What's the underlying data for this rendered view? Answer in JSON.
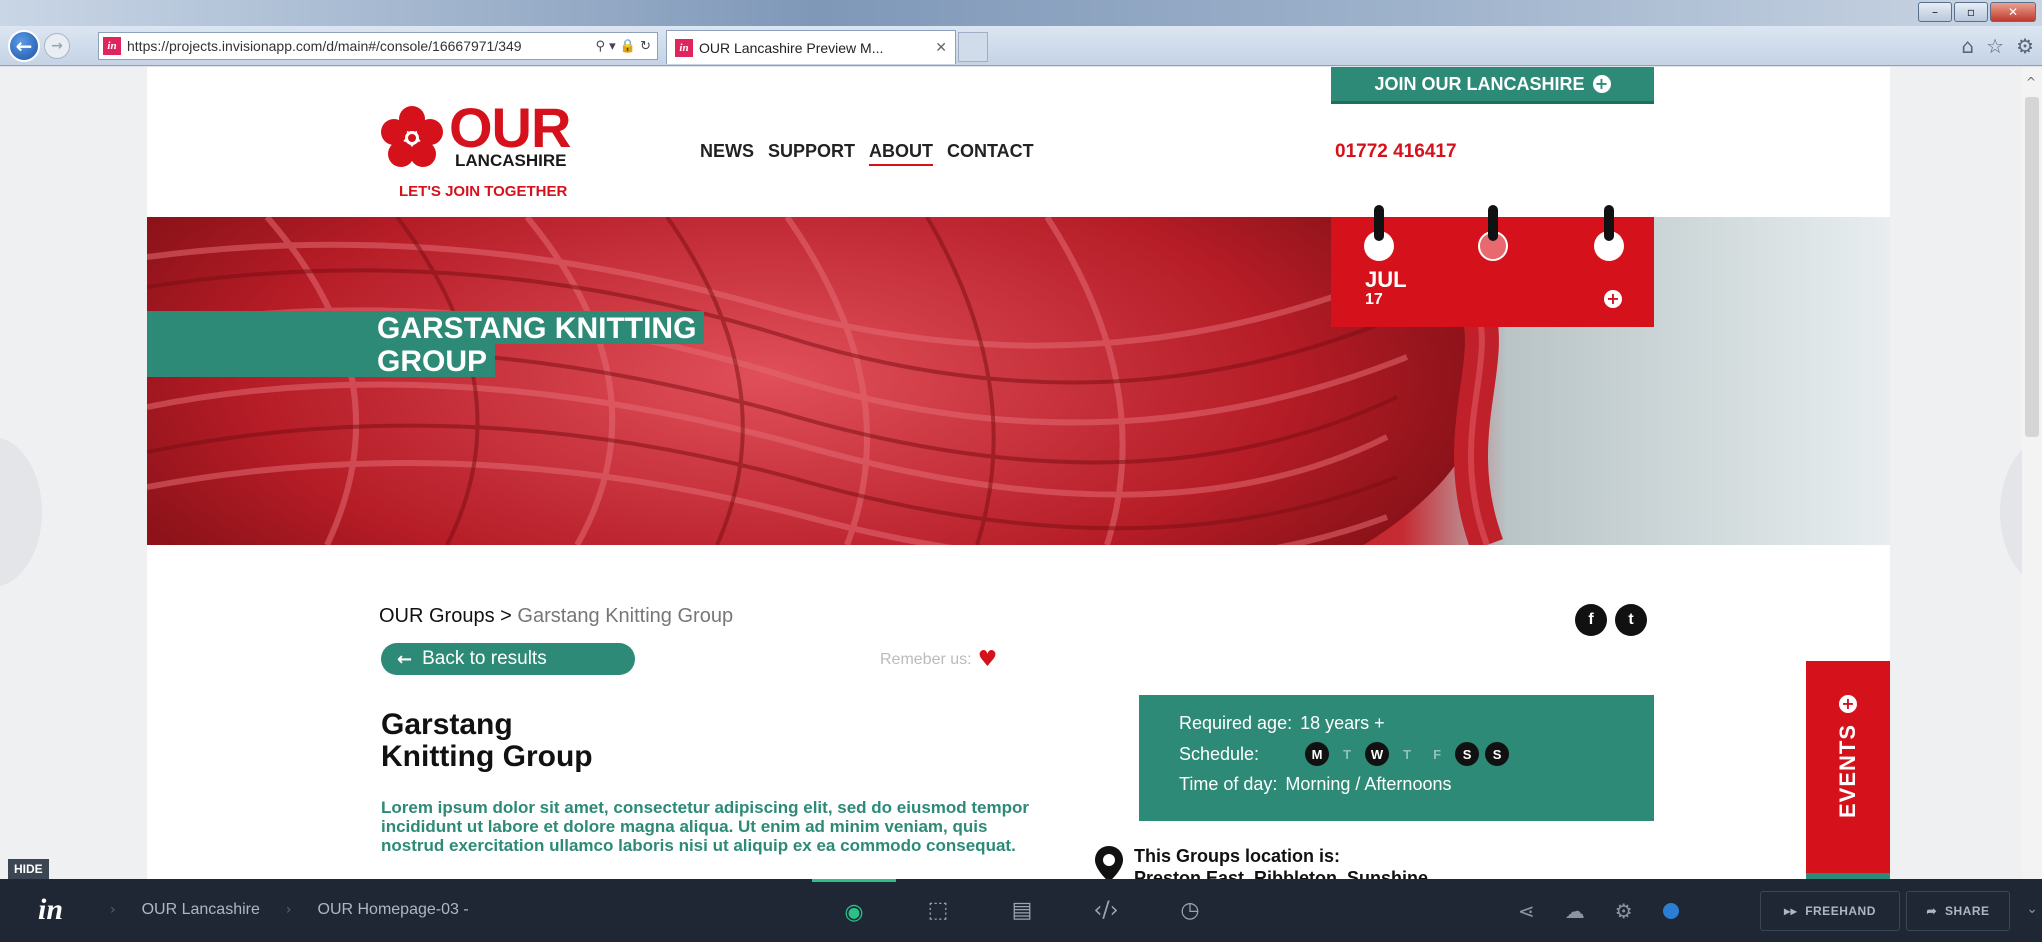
{
  "browser": {
    "url": "https://projects.invisionapp.com/d/main#/console/16667971/349",
    "url_icons": "⚲ ▾ 🔒 ↻",
    "tab_title": "OUR Lancashire Preview M...",
    "tab_close": "✕",
    "favicon_letter": "in",
    "win_minimize": "–",
    "win_maximize": "▫",
    "win_close": "✕",
    "home_icon": "⌂",
    "star_icon": "☆",
    "gear_icon": "⚙"
  },
  "site": {
    "join_label": "JOIN OUR LANCASHIRE",
    "logo_our": "OUR",
    "logo_lancashire": "LANCASHIRE",
    "logo_tagline": "LET'S JOIN TOGETHER",
    "nav": [
      "NEWS",
      "SUPPORT",
      "ABOUT",
      "CONTACT"
    ],
    "nav_active": "ABOUT",
    "phone": "01772 416417",
    "colors": {
      "brand_red": "#d5121b",
      "brand_teal": "#2d8a77"
    }
  },
  "hero": {
    "title_line1": "GARSTANG KNITTING",
    "title_line2": "GROUP"
  },
  "calendar": {
    "month": "JUL",
    "day": "17"
  },
  "content": {
    "crumb_root": "OUR Groups >",
    "crumb_current": "Garstang Knitting Group",
    "back_label": "Back to results",
    "remember_label": "Remeber us:",
    "title_line1": "Garstang",
    "title_line2": "Knitting Group",
    "lorem": "Lorem ipsum dolor sit amet, consectetur adipiscing elit, sed do eiusmod tempor incididunt ut labore et dolore magna aliqua. Ut enim ad minim veniam, quis nostrud exercitation ullamco laboris nisi ut aliquip ex ea commodo consequat."
  },
  "info": {
    "age_label": "Required age:",
    "age_value": "18 years +",
    "schedule_label": "Schedule:",
    "days": [
      {
        "letter": "M",
        "on": true
      },
      {
        "letter": "T",
        "on": false
      },
      {
        "letter": "W",
        "on": true
      },
      {
        "letter": "T",
        "on": false
      },
      {
        "letter": "F",
        "on": false
      },
      {
        "letter": "S",
        "on": true
      },
      {
        "letter": "S",
        "on": true
      }
    ],
    "time_label": "Time of day:",
    "time_value": "Morning / Afternoons"
  },
  "location": {
    "heading": "This Groups location is:",
    "value": "Preston East, Ribbleton, Sunshine"
  },
  "events_label": "EVENTS",
  "hide_label": "HIDE",
  "invision": {
    "logo": "in",
    "crumbs": [
      "OUR Lancashire",
      "OUR Homepage-03 -"
    ],
    "freehand_label": "FREEHAND",
    "share_label": "SHARE"
  }
}
